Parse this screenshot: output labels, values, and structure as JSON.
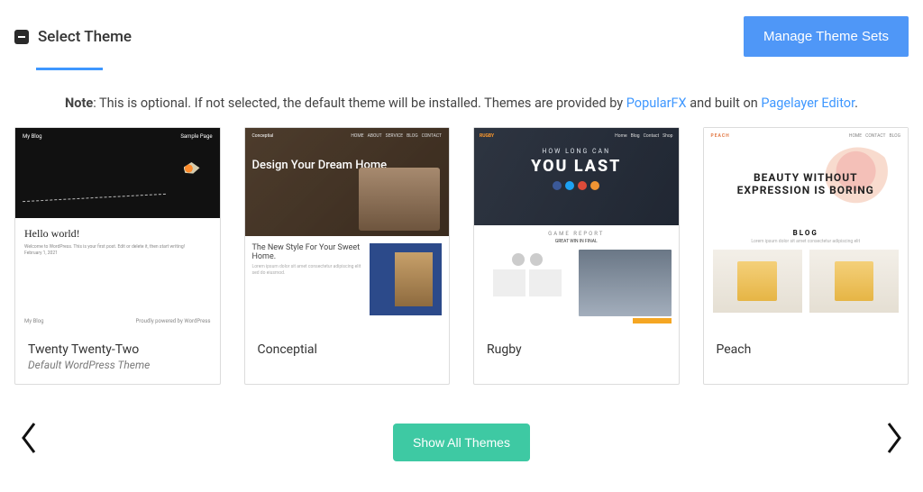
{
  "header": {
    "title": "Select Theme",
    "manage_button": "Manage Theme Sets"
  },
  "note": {
    "prefix_bold": "Note",
    "text_1": ": This is optional. If not selected, the default theme will be installed. Themes are provided by ",
    "link_1": "PopularFX",
    "text_2": " and built on ",
    "link_2": "Pagelayer Editor",
    "text_3": "."
  },
  "themes": [
    {
      "title": "Twenty Twenty-Two",
      "subtitle": "Default WordPress Theme",
      "preview": {
        "brand": "My Blog",
        "nav_item": "Sample Page",
        "hello": "Hello world!",
        "meta": "Welcome to WordPress. This is your first post. Edit or delete it, then start writing!",
        "date": "February 1, 2021",
        "footer_left": "My Blog",
        "footer_right": "Proudly powered by WordPress"
      }
    },
    {
      "title": "Conceptial",
      "preview": {
        "brand": "Conceptial",
        "headline": "Design Your Dream Home",
        "sub_h": "The New Style For Your Sweet Home."
      }
    },
    {
      "title": "Rugby",
      "preview": {
        "brand": "RUGBY",
        "kicker": "HOW LONG CAN",
        "headline": "YOU LAST",
        "section": "GAME REPORT",
        "subline": "GREAT WIN IN FINAL"
      }
    },
    {
      "title": "Peach",
      "preview": {
        "brand": "PEACH",
        "headline1": "BEAUTY WITHOUT",
        "headline2": "EXPRESSION IS BORING",
        "section": "BLOG"
      }
    }
  ],
  "controls": {
    "show_all": "Show All Themes"
  }
}
